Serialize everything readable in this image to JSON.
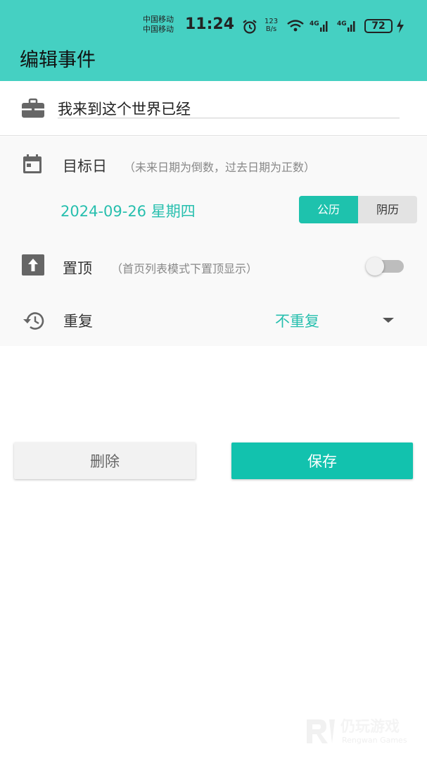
{
  "status_bar": {
    "carrier_1": "中国移动",
    "carrier_2": "中国移动",
    "time": "11:24",
    "net_speed_top": "123",
    "net_speed_bottom": "B/s",
    "sig1_label": "4G",
    "sig2_label": "4G",
    "battery": "72"
  },
  "header": {
    "title": "编辑事件"
  },
  "event": {
    "name": "我来到这个世界已经"
  },
  "target_date": {
    "label": "目标日",
    "hint": "（未来日期为倒数，过去日期为正数）",
    "value": "2024-09-26 星期四",
    "calendar_options": [
      "公历",
      "阴历"
    ],
    "selected": "公历"
  },
  "pin_top": {
    "label": "置顶",
    "hint": "（首页列表模式下置顶显示）",
    "enabled": false
  },
  "repeat": {
    "label": "重复",
    "value": "不重复"
  },
  "actions": {
    "delete_label": "删除",
    "save_label": "保存"
  },
  "watermark": {
    "cn": "仍玩游戏",
    "en": "Rengwan Games"
  },
  "colors": {
    "accent": "#45d0c2",
    "accent_dark": "#12c2ae",
    "value_text": "#27bfae"
  }
}
